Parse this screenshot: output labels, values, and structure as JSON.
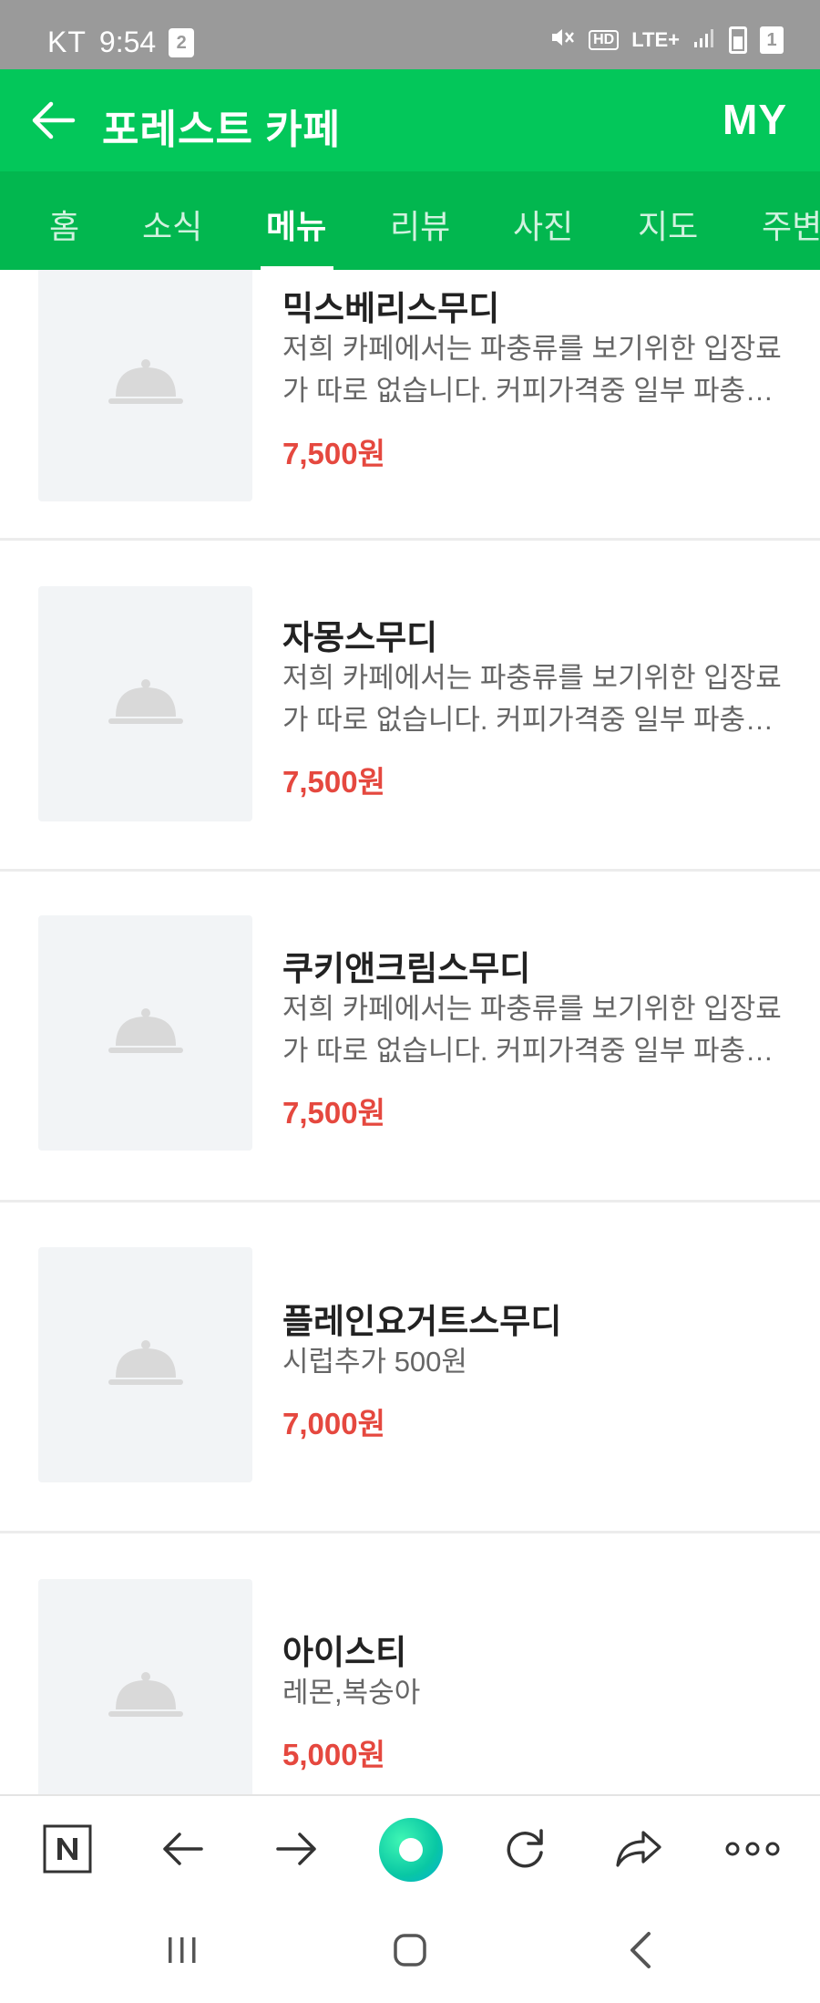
{
  "status_bar": {
    "carrier": "KT",
    "time": "9:54",
    "sim_indicator": "2",
    "network": "LTE+",
    "sim_slot": "1"
  },
  "header": {
    "title": "포레스트 카페",
    "right_label": "MY"
  },
  "tabs": [
    {
      "label": "홈",
      "active": false
    },
    {
      "label": "소식",
      "active": false
    },
    {
      "label": "메뉴",
      "active": true
    },
    {
      "label": "리뷰",
      "active": false
    },
    {
      "label": "사진",
      "active": false
    },
    {
      "label": "지도",
      "active": false
    },
    {
      "label": "주변",
      "active": false
    }
  ],
  "menu_items": [
    {
      "name": "믹스베리스무디",
      "desc_line1": "저희 카페에서는 파충류를 보기위한 입장료",
      "desc_line2": "가 따로 없습니다. 커피가격중 일부 파충류...",
      "price": "7,500원"
    },
    {
      "name": "자몽스무디",
      "desc_line1": "저희 카페에서는 파충류를 보기위한 입장료",
      "desc_line2": "가 따로 없습니다. 커피가격중 일부 파충류...",
      "price": "7,500원"
    },
    {
      "name": "쿠키앤크림스무디",
      "desc_line1": "저희 카페에서는 파충류를 보기위한 입장료",
      "desc_line2": "가 따로 없습니다. 커피가격중 일부 파충류...",
      "price": "7,500원"
    },
    {
      "name": "플레인요거트스무디",
      "desc_line1": "시럽추가 500원",
      "price": "7,000원"
    },
    {
      "name": "아이스티",
      "desc_line1": "레몬,복숭아",
      "price": "5,000원"
    }
  ],
  "colors": {
    "header_green": "#03c75a",
    "tab_green": "#02b74f",
    "price_red": "#e5483f"
  },
  "icons": {
    "back": "arrow-left-icon",
    "placeholder": "food-cloche-icon",
    "naver": "naver-n-icon",
    "browser_back": "arrow-left-icon",
    "browser_forward": "arrow-right-icon",
    "green_dot": "green-dot-icon",
    "refresh": "refresh-icon",
    "share": "share-icon",
    "more": "more-icon"
  }
}
